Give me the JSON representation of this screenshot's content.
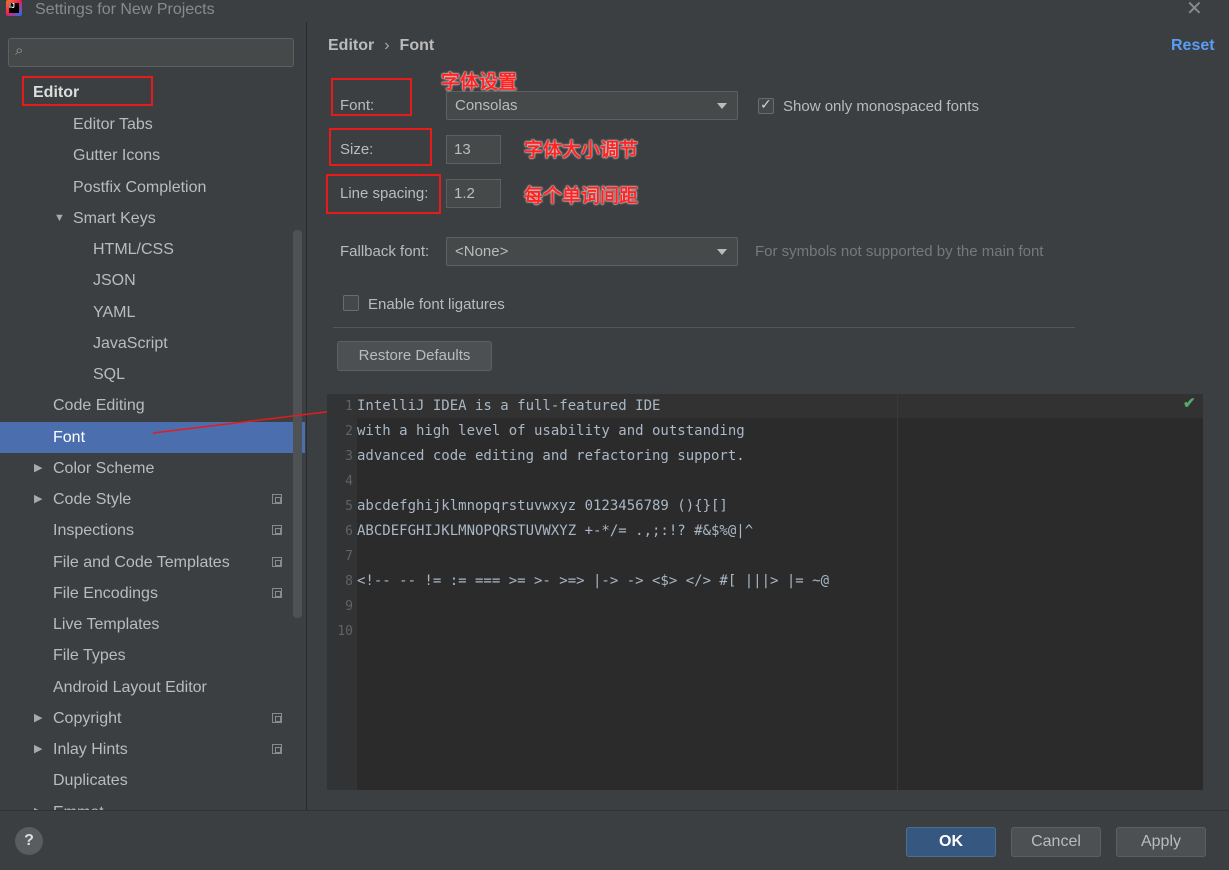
{
  "window": {
    "title": "Settings for New Projects",
    "close": "✕"
  },
  "search": {
    "placeholder": ""
  },
  "sidebar": {
    "items": [
      {
        "label": "Editor"
      },
      {
        "label": "Editor Tabs"
      },
      {
        "label": "Gutter Icons"
      },
      {
        "label": "Postfix Completion"
      },
      {
        "label": "Smart Keys"
      },
      {
        "label": "HTML/CSS"
      },
      {
        "label": "JSON"
      },
      {
        "label": "YAML"
      },
      {
        "label": "JavaScript"
      },
      {
        "label": "SQL"
      },
      {
        "label": "Code Editing"
      },
      {
        "label": "Font"
      },
      {
        "label": "Color Scheme"
      },
      {
        "label": "Code Style"
      },
      {
        "label": "Inspections"
      },
      {
        "label": "File and Code Templates"
      },
      {
        "label": "File Encodings"
      },
      {
        "label": "Live Templates"
      },
      {
        "label": "File Types"
      },
      {
        "label": "Android Layout Editor"
      },
      {
        "label": "Copyright"
      },
      {
        "label": "Inlay Hints"
      },
      {
        "label": "Duplicates"
      },
      {
        "label": "Emmet"
      }
    ]
  },
  "breadcrumb": {
    "parent": "Editor",
    "current": "Font",
    "separator": "›"
  },
  "reset_label": "Reset",
  "form": {
    "font_label": "Font:",
    "font_value": "Consolas",
    "show_monospaced_label": "Show only monospaced fonts",
    "show_monospaced_checked": true,
    "size_label": "Size:",
    "size_value": "13",
    "line_spacing_label": "Line spacing:",
    "line_spacing_value": "1.2",
    "fallback_label": "Fallback font:",
    "fallback_value": "<None>",
    "fallback_hint": "For symbols not supported by the main font",
    "ligatures_label": "Enable font ligatures",
    "ligatures_checked": false,
    "restore_defaults_label": "Restore Defaults"
  },
  "annotations": {
    "font_note": "字体设置",
    "size_note": "字体大小调节",
    "spacing_note": "每个单词间距"
  },
  "preview": {
    "line_numbers": [
      "1",
      "2",
      "3",
      "4",
      "5",
      "6",
      "7",
      "8",
      "9",
      "10"
    ],
    "lines": [
      "IntelliJ IDEA is a full-featured IDE",
      "with a high level of usability and outstanding",
      "advanced code editing and refactoring support.",
      "",
      "abcdefghijklmnopqrstuvwxyz 0123456789 (){}[]",
      "ABCDEFGHIJKLMNOPQRSTUVWXYZ +-*/= .,;:!? #&$%@|^",
      "",
      "<!-- -- != := === >= >- >=> |-> -> <$> </> #[ |||> |= ~@",
      "",
      ""
    ]
  },
  "footer": {
    "help": "?",
    "ok": "OK",
    "cancel": "Cancel",
    "apply": "Apply"
  }
}
